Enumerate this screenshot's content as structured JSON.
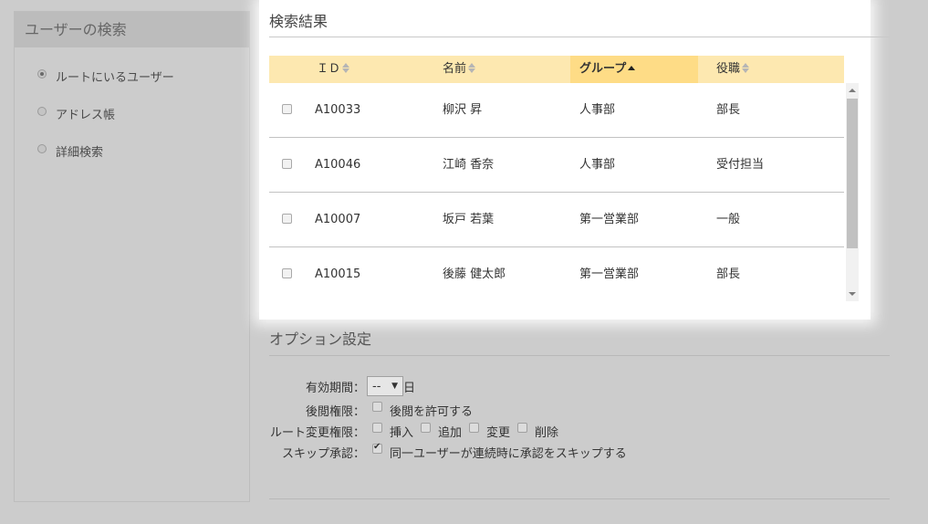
{
  "sidebar": {
    "title": "ユーザーの検索",
    "options": [
      {
        "label": "ルートにいるユーザー",
        "selected": true
      },
      {
        "label": "アドレス帳",
        "selected": false
      },
      {
        "label": "詳細検索",
        "selected": false
      }
    ]
  },
  "results": {
    "title": "検索結果",
    "columns": {
      "id": "ＩＤ",
      "name": "名前",
      "group": "グループ",
      "position": "役職"
    },
    "sorted_column": "group",
    "rows": [
      {
        "id": "A10033",
        "name": "柳沢 昇",
        "group": "人事部",
        "position": "部長",
        "checked": false
      },
      {
        "id": "A10046",
        "name": "江崎 香奈",
        "group": "人事部",
        "position": "受付担当",
        "checked": false
      },
      {
        "id": "A10007",
        "name": "坂戸 若葉",
        "group": "第一営業部",
        "position": "一般",
        "checked": false
      },
      {
        "id": "A10015",
        "name": "後藤 健太郎",
        "group": "第一営業部",
        "position": "部長",
        "checked": false
      }
    ]
  },
  "options": {
    "title": "オプション設定",
    "validity": {
      "label": "有効期間：",
      "value": "--",
      "unit": "日"
    },
    "view_permission": {
      "label": "後閲権限：",
      "checkbox_label": "後閲を許可する",
      "checked": false
    },
    "route_permission": {
      "label": "ルート変更権限：",
      "items": [
        {
          "label": "挿入",
          "checked": false
        },
        {
          "label": "追加",
          "checked": false
        },
        {
          "label": "変更",
          "checked": false
        },
        {
          "label": "削除",
          "checked": false
        }
      ]
    },
    "skip_approval": {
      "label": "スキップ承認：",
      "checkbox_label": "同一ユーザーが連続時に承認をスキップする",
      "checked": true
    }
  },
  "colors": {
    "background": "#cccccc",
    "header_row": "#fde8b0",
    "header_active": "#fedc86"
  }
}
